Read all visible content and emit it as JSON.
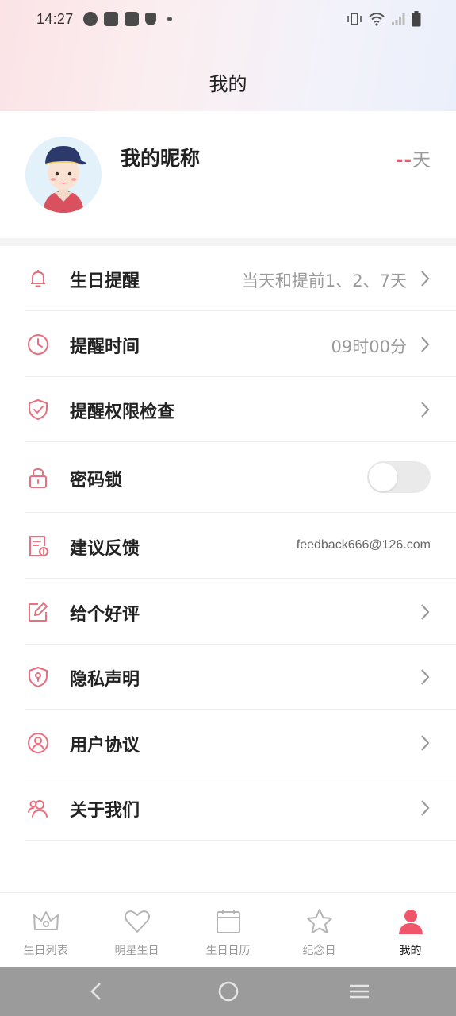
{
  "status_bar": {
    "time": "14:27"
  },
  "page": {
    "title": "我的"
  },
  "profile": {
    "nickname": "我的昵称",
    "days_dash": "--",
    "days_unit": "天"
  },
  "menu": [
    {
      "label": "生日提醒",
      "value": "当天和提前1、2、7天",
      "icon": "bell-icon"
    },
    {
      "label": "提醒时间",
      "value": "09时00分",
      "icon": "clock-icon"
    },
    {
      "label": "提醒权限检查",
      "value": "",
      "icon": "shield-check-icon"
    },
    {
      "label": "密码锁",
      "value": "",
      "icon": "lock-icon",
      "toggle": false
    },
    {
      "label": "建议反馈",
      "value": "feedback666@126.com",
      "icon": "feedback-icon"
    },
    {
      "label": "给个好评",
      "value": "",
      "icon": "edit-icon"
    },
    {
      "label": "隐私声明",
      "value": "",
      "icon": "privacy-shield-icon"
    },
    {
      "label": "用户协议",
      "value": "",
      "icon": "user-circle-icon"
    },
    {
      "label": "关于我们",
      "value": "",
      "icon": "people-icon"
    }
  ],
  "bottom_nav": [
    {
      "label": "生日列表",
      "icon": "crown-icon"
    },
    {
      "label": "明星生日",
      "icon": "heart-icon"
    },
    {
      "label": "生日日历",
      "icon": "calendar-icon"
    },
    {
      "label": "纪念日",
      "icon": "star-icon"
    },
    {
      "label": "我的",
      "icon": "person-icon",
      "active": true
    }
  ],
  "colors": {
    "accent": "#f0556a",
    "icon_pink": "#e8707f"
  }
}
